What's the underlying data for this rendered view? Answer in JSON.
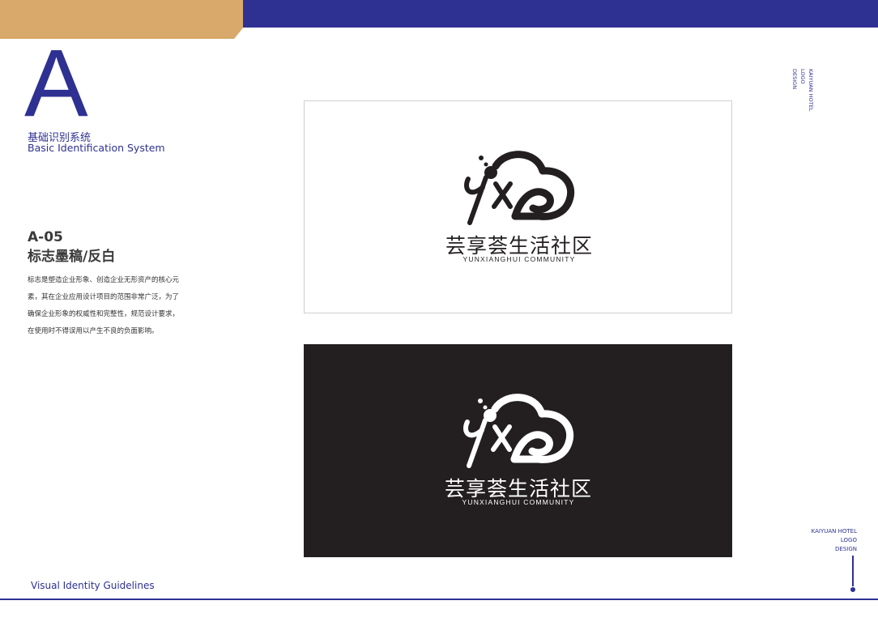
{
  "header": {
    "tan_color": "#d9a96b",
    "blue_color": "#2e3192"
  },
  "section": {
    "letter": "A",
    "system_cn": "基础识别系统",
    "system_en": "Basic Identification System",
    "code": "A-05",
    "title": "标志墨稿/反白",
    "description_lines": [
      "标志是塑造企业形象、创造企业无形资产的核心元",
      "素，其在企业应用设计项目的范围非常广泛，为了",
      "确保企业形象的权威性和完整性，规范设计要求，",
      "在使用时不得误用以产生不良的负面影响。"
    ]
  },
  "logo": {
    "name_cn": "芸享荟生活社区",
    "name_en": "YUNXIANGHUI COMMUNITY",
    "mark_icon": "cloud-yxh-logo-icon",
    "ink_color": "#231f20",
    "reverse_color": "#ffffff"
  },
  "side_label": {
    "line1": "KAIYUAN HOTEL",
    "line2": "LOGO",
    "line3": "DESIGN"
  },
  "footer": {
    "text": "Visual Identity Guidelines"
  }
}
